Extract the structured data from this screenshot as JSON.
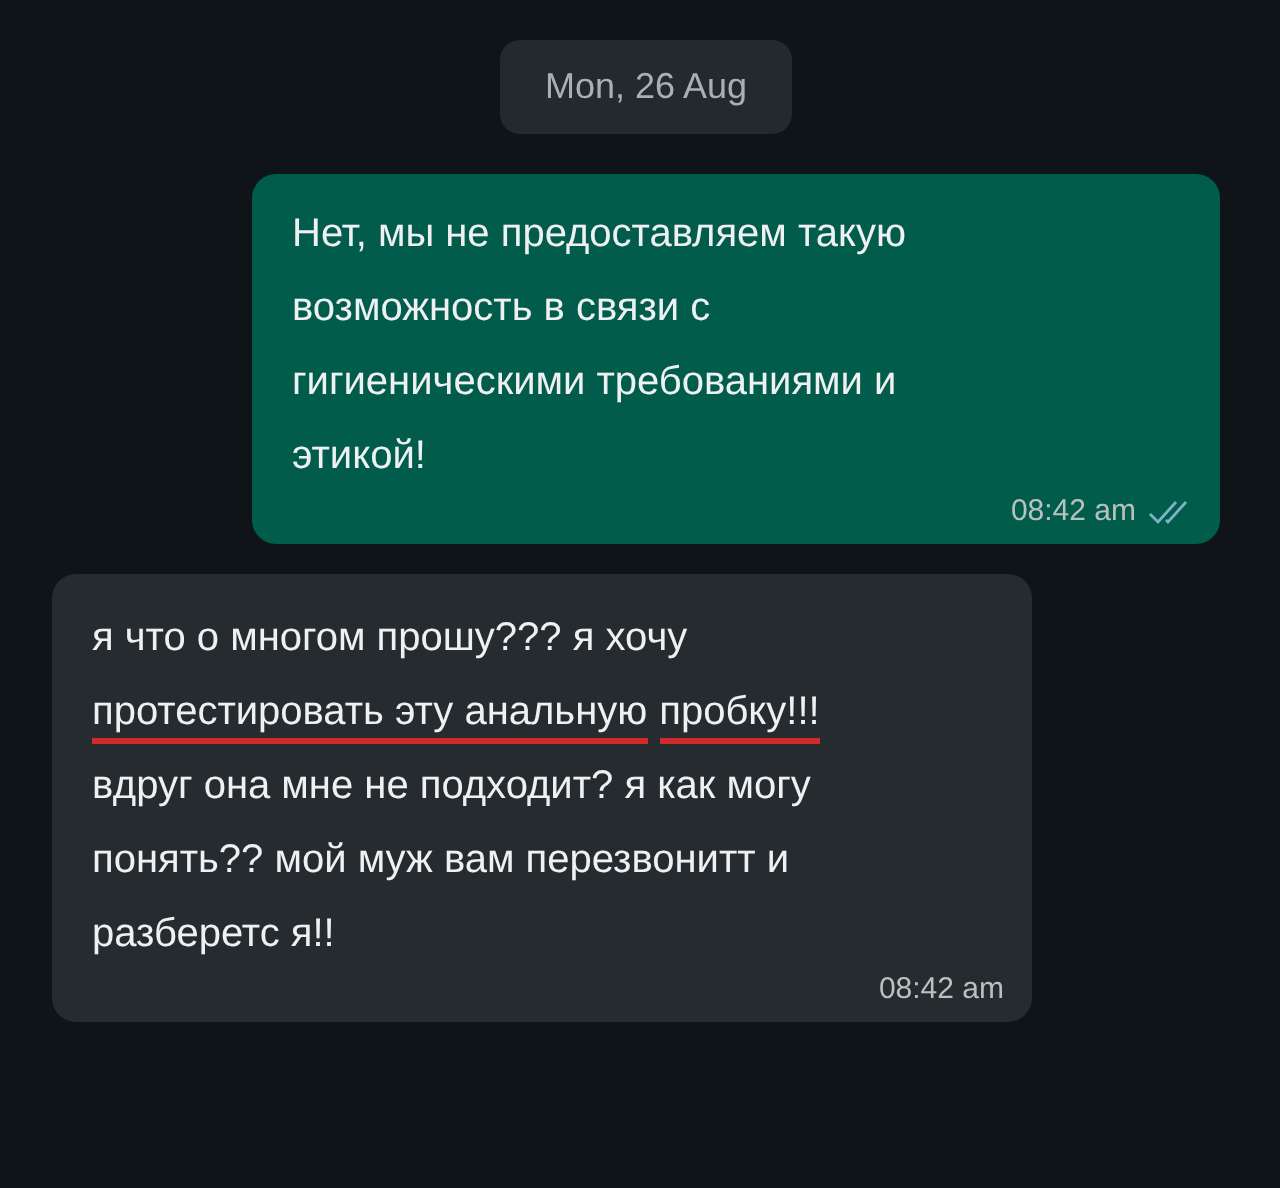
{
  "date_chip": "Mon, 26 Aug",
  "messages": [
    {
      "kind": "outgoing",
      "segments": [
        {
          "text": "Нет, мы не предоставляем такую возможность в связи с гигиеническими требованиями и этикой!",
          "underlined": false
        }
      ],
      "time": "08:42 am",
      "read": true
    },
    {
      "kind": "incoming",
      "segments": [
        {
          "text": "я что о многом прошу??? я хочу ",
          "underlined": false
        },
        {
          "text": "протестировать эту анальную",
          "underlined": true
        },
        {
          "text": "пробку!!!",
          "underlined": true
        },
        {
          "text": " вдруг она мне не подходит? я как могу понять?? мой муж вам перезвонитт и разберетс я!!",
          "underlined": false
        }
      ],
      "time": "08:42 am"
    }
  ]
}
